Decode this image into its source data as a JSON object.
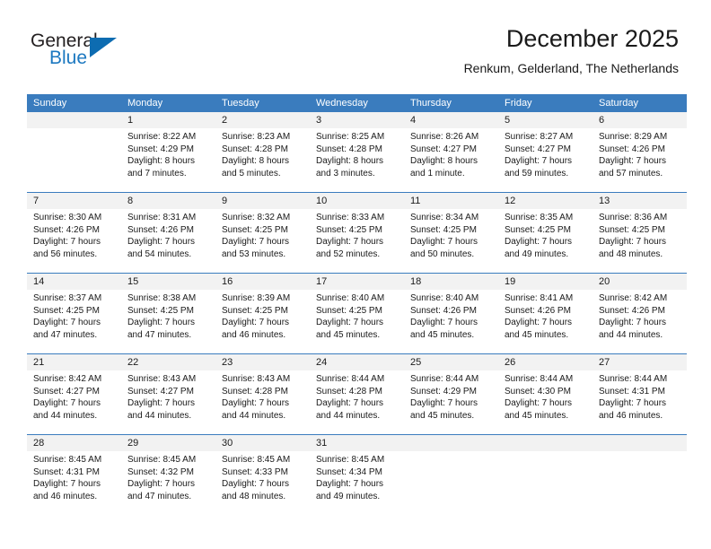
{
  "brand": {
    "name_top": "General",
    "name_bottom": "Blue",
    "accent_color": "#0d6cb1",
    "text_color": "#231f20"
  },
  "header": {
    "title": "December 2025",
    "subtitle": "Renkum, Gelderland, The Netherlands"
  },
  "theme": {
    "header_blue": "#3a7cbe",
    "day_band_gray": "#f2f2f2",
    "text": "#1a1a1a"
  },
  "calendar": {
    "weekdays": [
      "Sunday",
      "Monday",
      "Tuesday",
      "Wednesday",
      "Thursday",
      "Friday",
      "Saturday"
    ],
    "weeks": [
      [
        {
          "day": "",
          "sunrise": "",
          "sunset": "",
          "daylight_line1": "",
          "daylight_line2": ""
        },
        {
          "day": "1",
          "sunrise": "Sunrise: 8:22 AM",
          "sunset": "Sunset: 4:29 PM",
          "daylight_line1": "Daylight: 8 hours",
          "daylight_line2": "and 7 minutes."
        },
        {
          "day": "2",
          "sunrise": "Sunrise: 8:23 AM",
          "sunset": "Sunset: 4:28 PM",
          "daylight_line1": "Daylight: 8 hours",
          "daylight_line2": "and 5 minutes."
        },
        {
          "day": "3",
          "sunrise": "Sunrise: 8:25 AM",
          "sunset": "Sunset: 4:28 PM",
          "daylight_line1": "Daylight: 8 hours",
          "daylight_line2": "and 3 minutes."
        },
        {
          "day": "4",
          "sunrise": "Sunrise: 8:26 AM",
          "sunset": "Sunset: 4:27 PM",
          "daylight_line1": "Daylight: 8 hours",
          "daylight_line2": "and 1 minute."
        },
        {
          "day": "5",
          "sunrise": "Sunrise: 8:27 AM",
          "sunset": "Sunset: 4:27 PM",
          "daylight_line1": "Daylight: 7 hours",
          "daylight_line2": "and 59 minutes."
        },
        {
          "day": "6",
          "sunrise": "Sunrise: 8:29 AM",
          "sunset": "Sunset: 4:26 PM",
          "daylight_line1": "Daylight: 7 hours",
          "daylight_line2": "and 57 minutes."
        }
      ],
      [
        {
          "day": "7",
          "sunrise": "Sunrise: 8:30 AM",
          "sunset": "Sunset: 4:26 PM",
          "daylight_line1": "Daylight: 7 hours",
          "daylight_line2": "and 56 minutes."
        },
        {
          "day": "8",
          "sunrise": "Sunrise: 8:31 AM",
          "sunset": "Sunset: 4:26 PM",
          "daylight_line1": "Daylight: 7 hours",
          "daylight_line2": "and 54 minutes."
        },
        {
          "day": "9",
          "sunrise": "Sunrise: 8:32 AM",
          "sunset": "Sunset: 4:25 PM",
          "daylight_line1": "Daylight: 7 hours",
          "daylight_line2": "and 53 minutes."
        },
        {
          "day": "10",
          "sunrise": "Sunrise: 8:33 AM",
          "sunset": "Sunset: 4:25 PM",
          "daylight_line1": "Daylight: 7 hours",
          "daylight_line2": "and 52 minutes."
        },
        {
          "day": "11",
          "sunrise": "Sunrise: 8:34 AM",
          "sunset": "Sunset: 4:25 PM",
          "daylight_line1": "Daylight: 7 hours",
          "daylight_line2": "and 50 minutes."
        },
        {
          "day": "12",
          "sunrise": "Sunrise: 8:35 AM",
          "sunset": "Sunset: 4:25 PM",
          "daylight_line1": "Daylight: 7 hours",
          "daylight_line2": "and 49 minutes."
        },
        {
          "day": "13",
          "sunrise": "Sunrise: 8:36 AM",
          "sunset": "Sunset: 4:25 PM",
          "daylight_line1": "Daylight: 7 hours",
          "daylight_line2": "and 48 minutes."
        }
      ],
      [
        {
          "day": "14",
          "sunrise": "Sunrise: 8:37 AM",
          "sunset": "Sunset: 4:25 PM",
          "daylight_line1": "Daylight: 7 hours",
          "daylight_line2": "and 47 minutes."
        },
        {
          "day": "15",
          "sunrise": "Sunrise: 8:38 AM",
          "sunset": "Sunset: 4:25 PM",
          "daylight_line1": "Daylight: 7 hours",
          "daylight_line2": "and 47 minutes."
        },
        {
          "day": "16",
          "sunrise": "Sunrise: 8:39 AM",
          "sunset": "Sunset: 4:25 PM",
          "daylight_line1": "Daylight: 7 hours",
          "daylight_line2": "and 46 minutes."
        },
        {
          "day": "17",
          "sunrise": "Sunrise: 8:40 AM",
          "sunset": "Sunset: 4:25 PM",
          "daylight_line1": "Daylight: 7 hours",
          "daylight_line2": "and 45 minutes."
        },
        {
          "day": "18",
          "sunrise": "Sunrise: 8:40 AM",
          "sunset": "Sunset: 4:26 PM",
          "daylight_line1": "Daylight: 7 hours",
          "daylight_line2": "and 45 minutes."
        },
        {
          "day": "19",
          "sunrise": "Sunrise: 8:41 AM",
          "sunset": "Sunset: 4:26 PM",
          "daylight_line1": "Daylight: 7 hours",
          "daylight_line2": "and 45 minutes."
        },
        {
          "day": "20",
          "sunrise": "Sunrise: 8:42 AM",
          "sunset": "Sunset: 4:26 PM",
          "daylight_line1": "Daylight: 7 hours",
          "daylight_line2": "and 44 minutes."
        }
      ],
      [
        {
          "day": "21",
          "sunrise": "Sunrise: 8:42 AM",
          "sunset": "Sunset: 4:27 PM",
          "daylight_line1": "Daylight: 7 hours",
          "daylight_line2": "and 44 minutes."
        },
        {
          "day": "22",
          "sunrise": "Sunrise: 8:43 AM",
          "sunset": "Sunset: 4:27 PM",
          "daylight_line1": "Daylight: 7 hours",
          "daylight_line2": "and 44 minutes."
        },
        {
          "day": "23",
          "sunrise": "Sunrise: 8:43 AM",
          "sunset": "Sunset: 4:28 PM",
          "daylight_line1": "Daylight: 7 hours",
          "daylight_line2": "and 44 minutes."
        },
        {
          "day": "24",
          "sunrise": "Sunrise: 8:44 AM",
          "sunset": "Sunset: 4:28 PM",
          "daylight_line1": "Daylight: 7 hours",
          "daylight_line2": "and 44 minutes."
        },
        {
          "day": "25",
          "sunrise": "Sunrise: 8:44 AM",
          "sunset": "Sunset: 4:29 PM",
          "daylight_line1": "Daylight: 7 hours",
          "daylight_line2": "and 45 minutes."
        },
        {
          "day": "26",
          "sunrise": "Sunrise: 8:44 AM",
          "sunset": "Sunset: 4:30 PM",
          "daylight_line1": "Daylight: 7 hours",
          "daylight_line2": "and 45 minutes."
        },
        {
          "day": "27",
          "sunrise": "Sunrise: 8:44 AM",
          "sunset": "Sunset: 4:31 PM",
          "daylight_line1": "Daylight: 7 hours",
          "daylight_line2": "and 46 minutes."
        }
      ],
      [
        {
          "day": "28",
          "sunrise": "Sunrise: 8:45 AM",
          "sunset": "Sunset: 4:31 PM",
          "daylight_line1": "Daylight: 7 hours",
          "daylight_line2": "and 46 minutes."
        },
        {
          "day": "29",
          "sunrise": "Sunrise: 8:45 AM",
          "sunset": "Sunset: 4:32 PM",
          "daylight_line1": "Daylight: 7 hours",
          "daylight_line2": "and 47 minutes."
        },
        {
          "day": "30",
          "sunrise": "Sunrise: 8:45 AM",
          "sunset": "Sunset: 4:33 PM",
          "daylight_line1": "Daylight: 7 hours",
          "daylight_line2": "and 48 minutes."
        },
        {
          "day": "31",
          "sunrise": "Sunrise: 8:45 AM",
          "sunset": "Sunset: 4:34 PM",
          "daylight_line1": "Daylight: 7 hours",
          "daylight_line2": "and 49 minutes."
        },
        {
          "day": "",
          "sunrise": "",
          "sunset": "",
          "daylight_line1": "",
          "daylight_line2": ""
        },
        {
          "day": "",
          "sunrise": "",
          "sunset": "",
          "daylight_line1": "",
          "daylight_line2": ""
        },
        {
          "day": "",
          "sunrise": "",
          "sunset": "",
          "daylight_line1": "",
          "daylight_line2": ""
        }
      ]
    ]
  }
}
